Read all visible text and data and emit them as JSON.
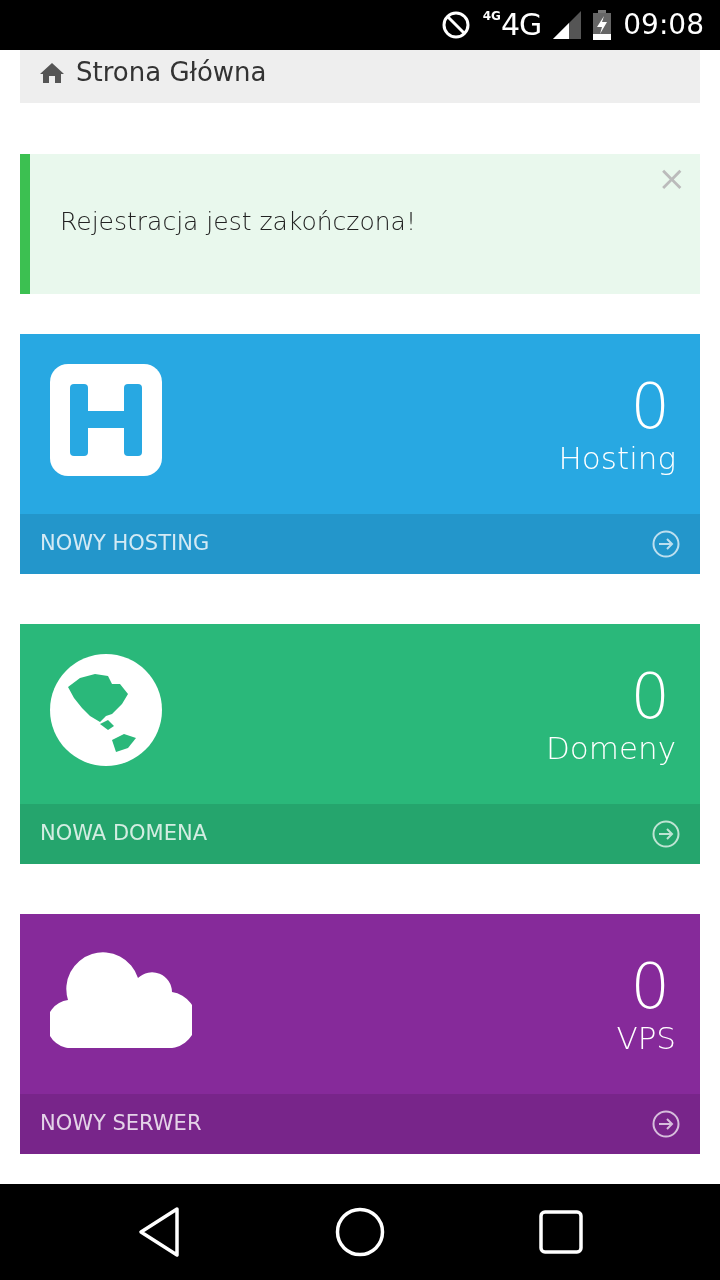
{
  "status_bar": {
    "network_small": "4G",
    "network": "4G",
    "time": "09:08"
  },
  "breadcrumb": {
    "label": "Strona Główna"
  },
  "alert": {
    "message": "Rejestracja jest zakończona!",
    "close": "×"
  },
  "cards": [
    {
      "kind": "hosting",
      "count": "0",
      "label": "Hosting",
      "action": "NOWY HOSTING",
      "color": "#28a8e2"
    },
    {
      "kind": "domain",
      "count": "0",
      "label": "Domeny",
      "action": "NOWA DOMENA",
      "color": "#2ab87a"
    },
    {
      "kind": "vps",
      "count": "0",
      "label": "VPS",
      "action": "NOWY SERWER",
      "color": "#862a9a"
    }
  ]
}
